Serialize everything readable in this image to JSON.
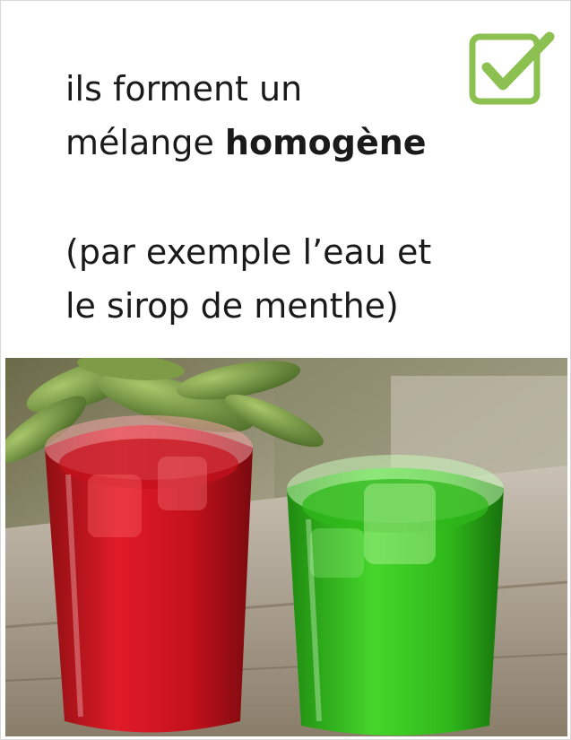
{
  "card": {
    "line1": "ils forment un",
    "line2_plain": "mélange ",
    "line2_bold": "homogène",
    "line3": "(par exemple l’eau et",
    "line4": "le sirop de menthe)"
  },
  "icons": {
    "check": "checkbox-checked-icon"
  },
  "colors": {
    "check_green": "#8cc152",
    "red_syrup": "#d3121f",
    "mint_syrup": "#36c11c"
  }
}
